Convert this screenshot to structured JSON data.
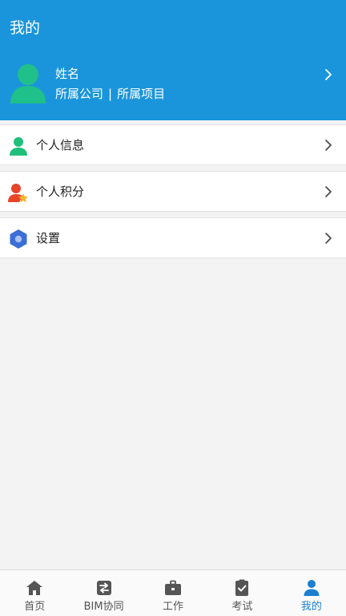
{
  "header": {
    "title": "我的",
    "background_color": "#1a95db",
    "profile": {
      "name": "姓名",
      "company": "所属公司",
      "separator": "|",
      "project": "所属项目",
      "avatar_color": "#1fc08a"
    }
  },
  "menu": [
    {
      "label": "个人信息",
      "icon": "person-icon",
      "icon_color": "#1fbf7a"
    },
    {
      "label": "个人积分",
      "icon": "person-star-icon",
      "icon_color": "#e8442a"
    },
    {
      "label": "设置",
      "icon": "gear-hexagon-icon",
      "icon_color": "#3b6fd6"
    }
  ],
  "tabbar": {
    "active_color": "#1a7fd0",
    "tabs": [
      {
        "label": "首页",
        "icon": "home-icon",
        "active": false
      },
      {
        "label": "BIM协同",
        "icon": "swap-icon",
        "active": false
      },
      {
        "label": "工作",
        "icon": "briefcase-icon",
        "active": false
      },
      {
        "label": "考试",
        "icon": "checklist-icon",
        "active": false
      },
      {
        "label": "我的",
        "icon": "person-icon",
        "active": true
      }
    ]
  }
}
